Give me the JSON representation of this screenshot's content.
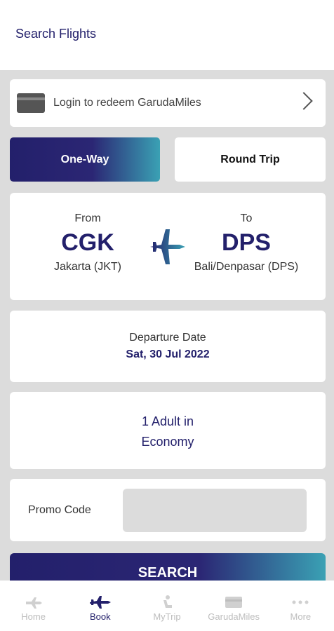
{
  "header": {
    "title": "Search Flights"
  },
  "login": {
    "label": "Login to redeem GarudaMiles"
  },
  "trip_type": {
    "one_way": "One-Way",
    "round_trip": "Round Trip",
    "selected": "One-Way"
  },
  "route": {
    "from_label": "From",
    "from_code": "CGK",
    "from_city": "Jakarta (JKT)",
    "to_label": "To",
    "to_code": "DPS",
    "to_city": "Bali/Denpasar (DPS)"
  },
  "departure": {
    "label": "Departure Date",
    "value": "Sat, 30 Jul 2022"
  },
  "passengers": {
    "line1": "1 Adult in",
    "line2": "Economy"
  },
  "promo": {
    "label": "Promo Code",
    "value": ""
  },
  "search_button": {
    "label": "SEARCH"
  },
  "nav": {
    "items": [
      {
        "label": "Home",
        "icon": "plane-landing-icon"
      },
      {
        "label": "Book",
        "icon": "plane-icon"
      },
      {
        "label": "MyTrip",
        "icon": "passenger-seat-icon"
      },
      {
        "label": "GarudaMiles",
        "icon": "card-icon"
      },
      {
        "label": "More",
        "icon": "more-dots-icon"
      }
    ],
    "active": "Book"
  },
  "colors": {
    "primary": "#23206b",
    "accent": "#3aa1b4",
    "background": "#dcdcdc"
  }
}
